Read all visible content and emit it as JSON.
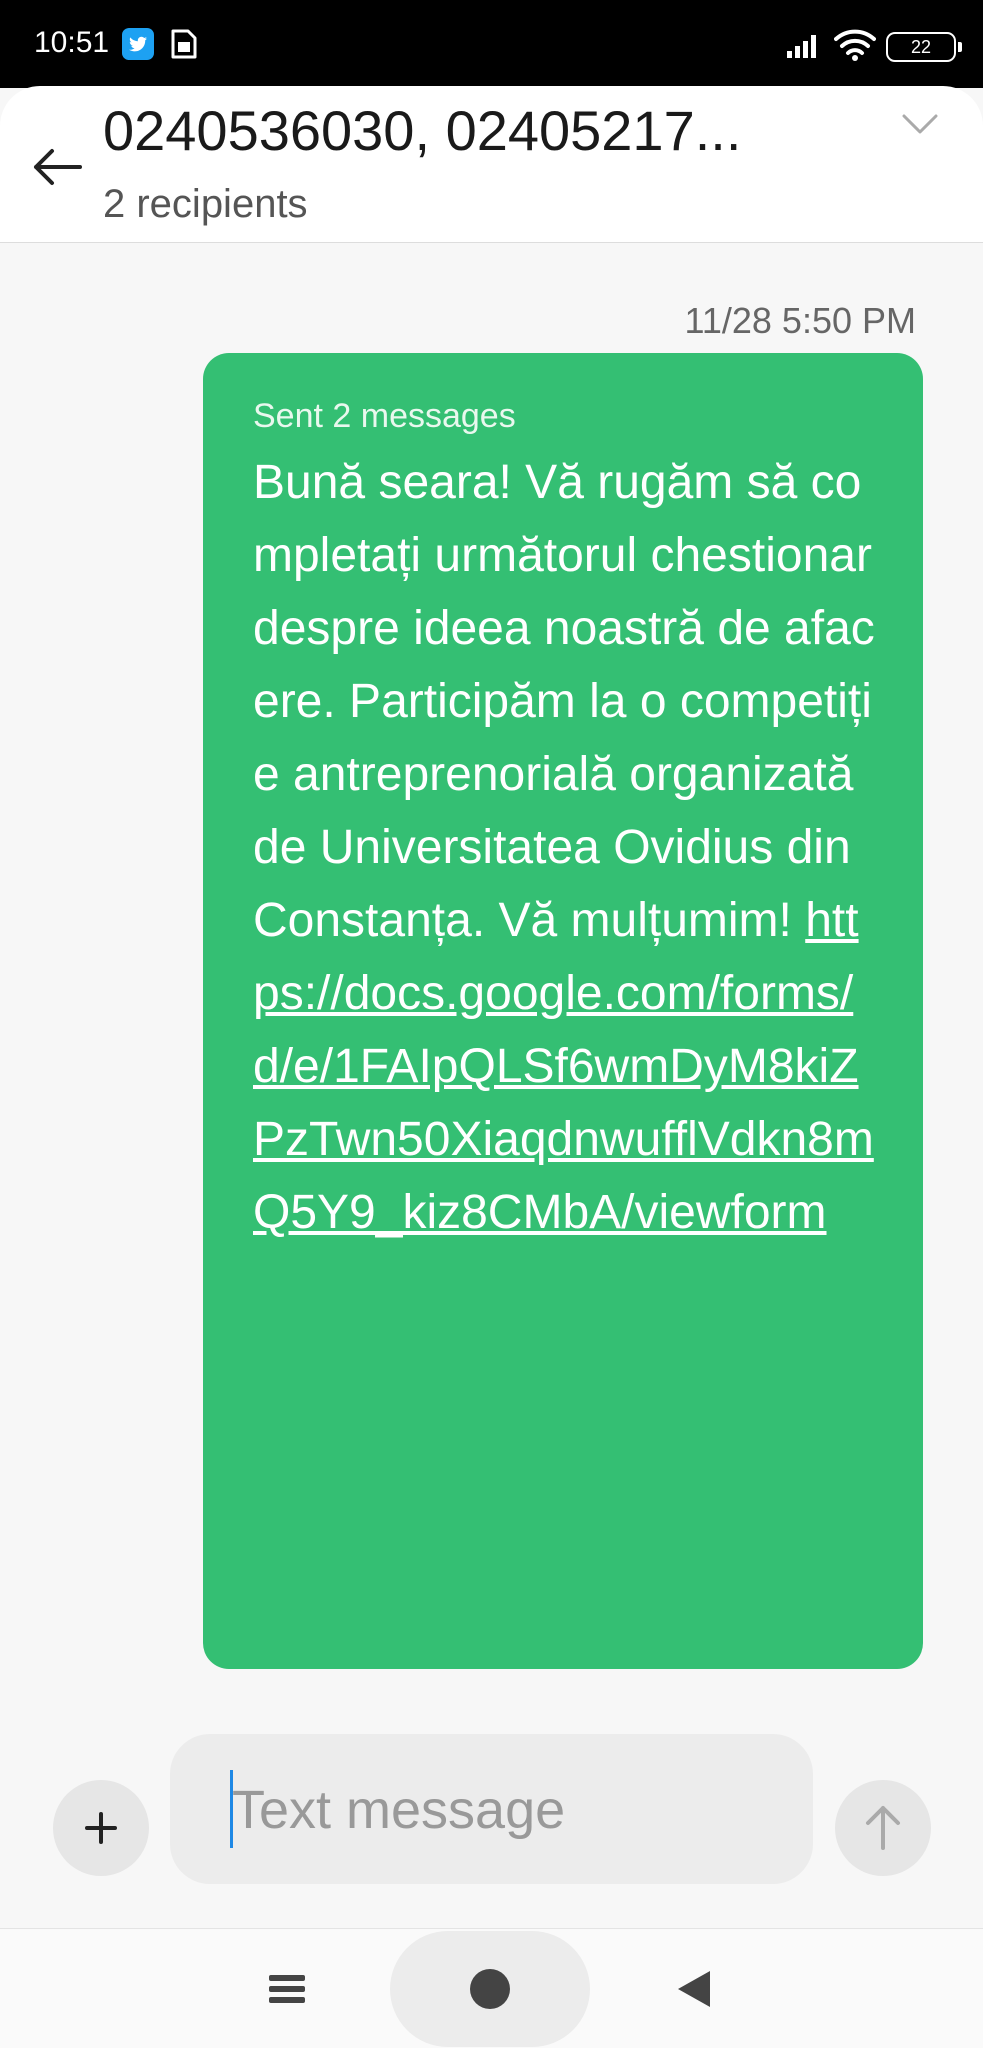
{
  "status_bar": {
    "time": "10:51",
    "battery": "22",
    "icons": [
      "twitter-icon",
      "sim-card-icon",
      "signal-icon",
      "wifi-icon",
      "battery-icon"
    ]
  },
  "header": {
    "title": "0240536030, 02405217...",
    "subtitle": "2 recipients",
    "back_icon": "back-arrow-icon",
    "expand_icon": "chevron-down-icon"
  },
  "conversation": {
    "timestamp": "11/28 5:50 PM",
    "message": {
      "meta": "Sent 2 messages",
      "text": "Bună seara! Vă rugăm să completați următorul chestionar despre ideea noastră de afacere. Participăm la o competiție antreprenorială organizată de Universitatea Ovidius din Constanța. Vă mulțumim! ",
      "link": "https://docs.google.com/forms/d/e/1FAIpQLSf6wmDyM8kiZPzTwn50XiaqdnwufflVdkn8mQ5Y9_kiz8CMbA/viewform",
      "bubble_color": "#34bf73"
    }
  },
  "composer": {
    "placeholder": "Text message",
    "value": "",
    "add_icon": "plus-icon",
    "send_icon": "send-arrow-up-icon"
  },
  "nav_bar": {
    "icons": [
      "menu-icon",
      "home-icon",
      "back-icon"
    ]
  }
}
